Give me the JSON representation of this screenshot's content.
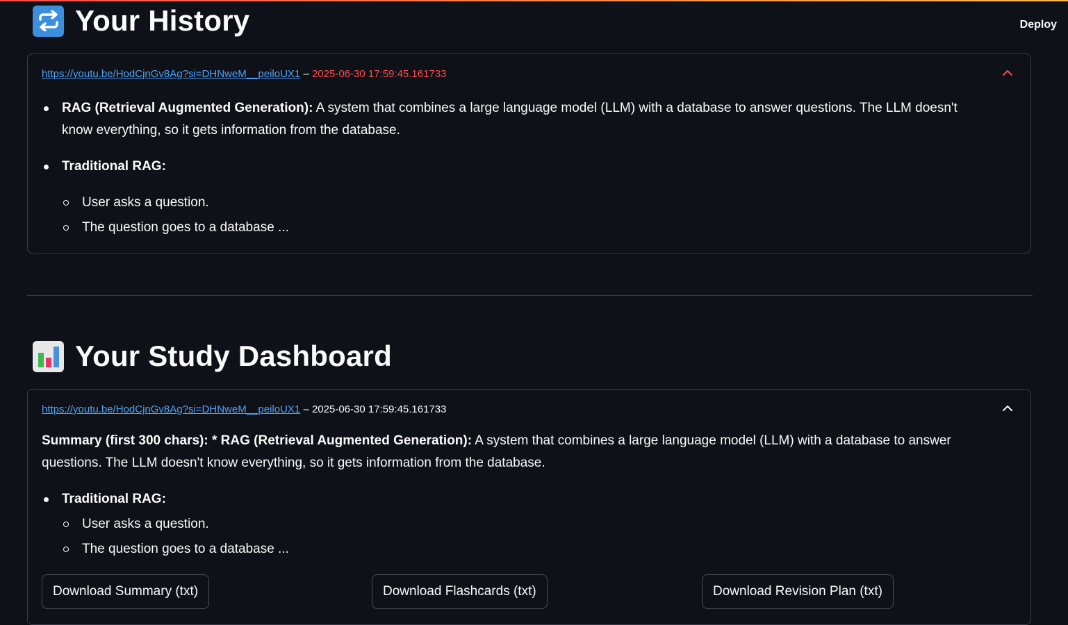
{
  "header": {
    "deploy_label": "Deploy"
  },
  "history": {
    "title": "Your History",
    "icon": "repeat-icon",
    "entry": {
      "link": "https://youtu.be/HodCjnGv8Ag?si=DHNweM__peiloUX1",
      "separator": " – ",
      "timestamp": "2025-06-30 17:59:45.161733",
      "item1_bold": "RAG (Retrieval Augmented Generation):",
      "item1_text": " A system that combines a large language model (LLM) with a database to answer questions. The LLM doesn't know everything, so it gets information from the database.",
      "item2_bold": "Traditional RAG:",
      "sub1": "User asks a question.",
      "sub2": "The question goes to a database ..."
    }
  },
  "dashboard": {
    "title": "Your Study Dashboard",
    "icon": "bar-chart-icon",
    "entry": {
      "link": "https://youtu.be/HodCjnGv8Ag?si=DHNweM__peiloUX1",
      "separator": " – ",
      "timestamp": "2025-06-30 17:59:45.161733",
      "summary_label": "Summary (first 300 chars):",
      "summary_star": " * ",
      "summary_bold": "RAG (Retrieval Augmented Generation):",
      "summary_text": " A system that combines a large language model (LLM) with a database to answer questions. The LLM doesn't know everything, so it gets information from the database.",
      "item_bold": "Traditional RAG:",
      "sub1": "User asks a question.",
      "sub2": "The question goes to a database ..."
    },
    "buttons": {
      "summary": "Download Summary (txt)",
      "flashcards": "Download Flashcards (txt)",
      "revision": "Download Revision Plan (txt)"
    }
  },
  "colors": {
    "background": "#0e1117",
    "link": "#4da3ff",
    "timestamp_history": "#ff4b4b",
    "border": "#3a3d46"
  }
}
